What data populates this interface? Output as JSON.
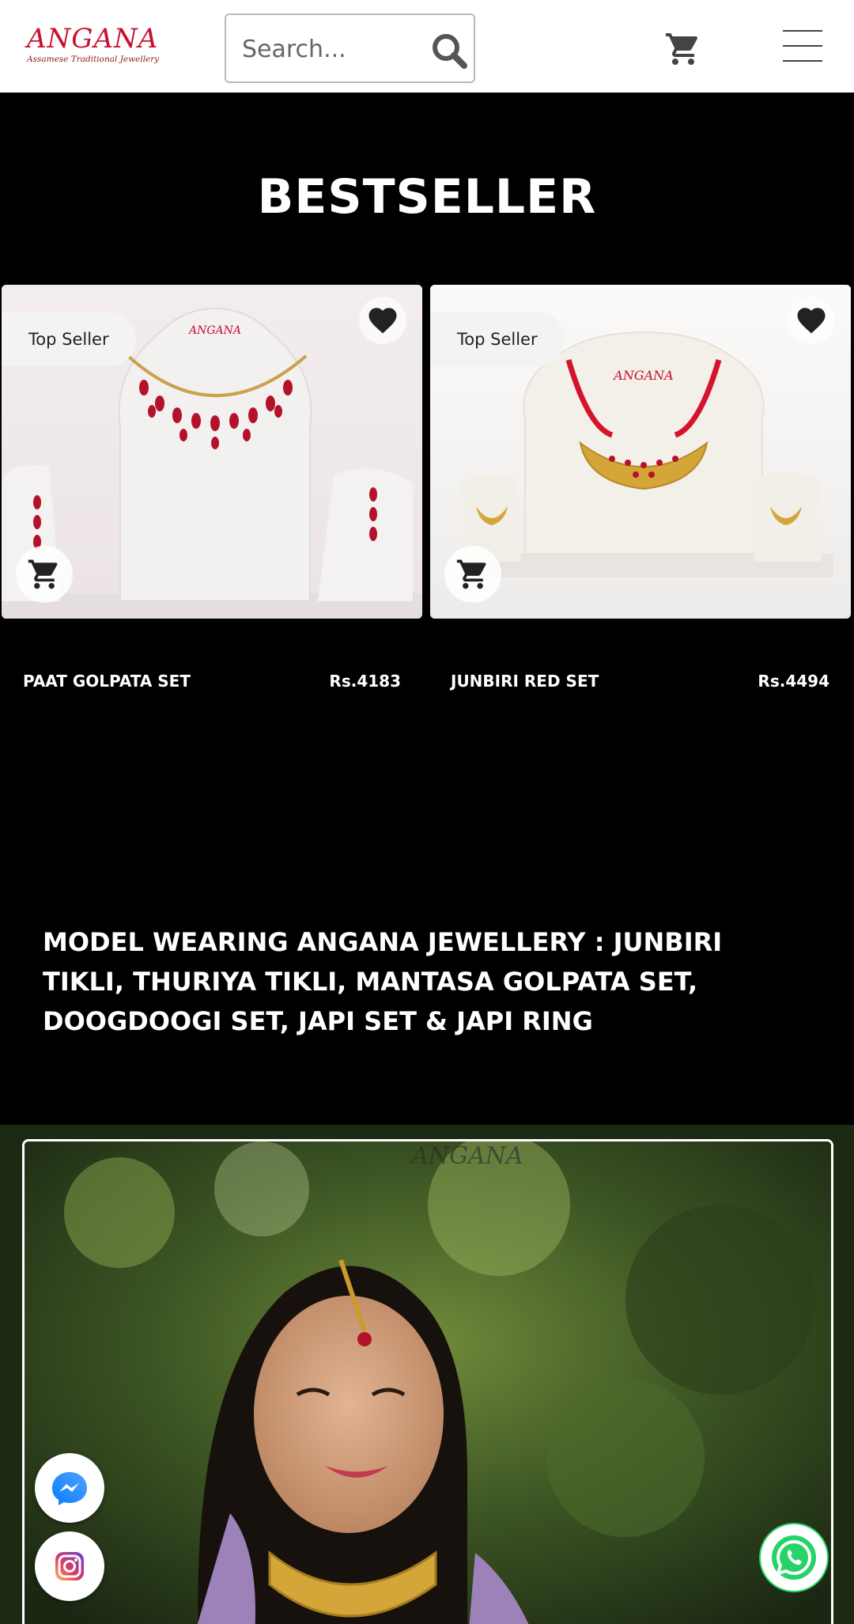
{
  "header": {
    "logo_title": "ANGANA",
    "logo_subtitle": "Assamese Traditional Jewellery",
    "search_placeholder": "Search..."
  },
  "bestseller": {
    "title": "BESTSELLER",
    "products": [
      {
        "badge": "Top Seller",
        "name": "PAAT GOLPATA SET",
        "price": "Rs.4183"
      },
      {
        "badge": "Top Seller",
        "name": "JUNBIRI RED SET",
        "price": "Rs.4494"
      }
    ]
  },
  "model_section": {
    "caption": "MODEL WEARING ANGANA JEWELLERY : JUNBIRI TIKLI, THURIYA TIKLI, MANTASA GOLPATA SET, DOOGDOOGI SET, JAPI SET & JAPI RING"
  },
  "icons": [
    "search-icon",
    "cart-icon",
    "menu-icon",
    "heart-icon",
    "messenger-icon",
    "instagram-icon",
    "whatsapp-icon"
  ],
  "colors": {
    "brand_red": "#c8102e",
    "background": "#000000",
    "whatsapp": "#25d366"
  }
}
